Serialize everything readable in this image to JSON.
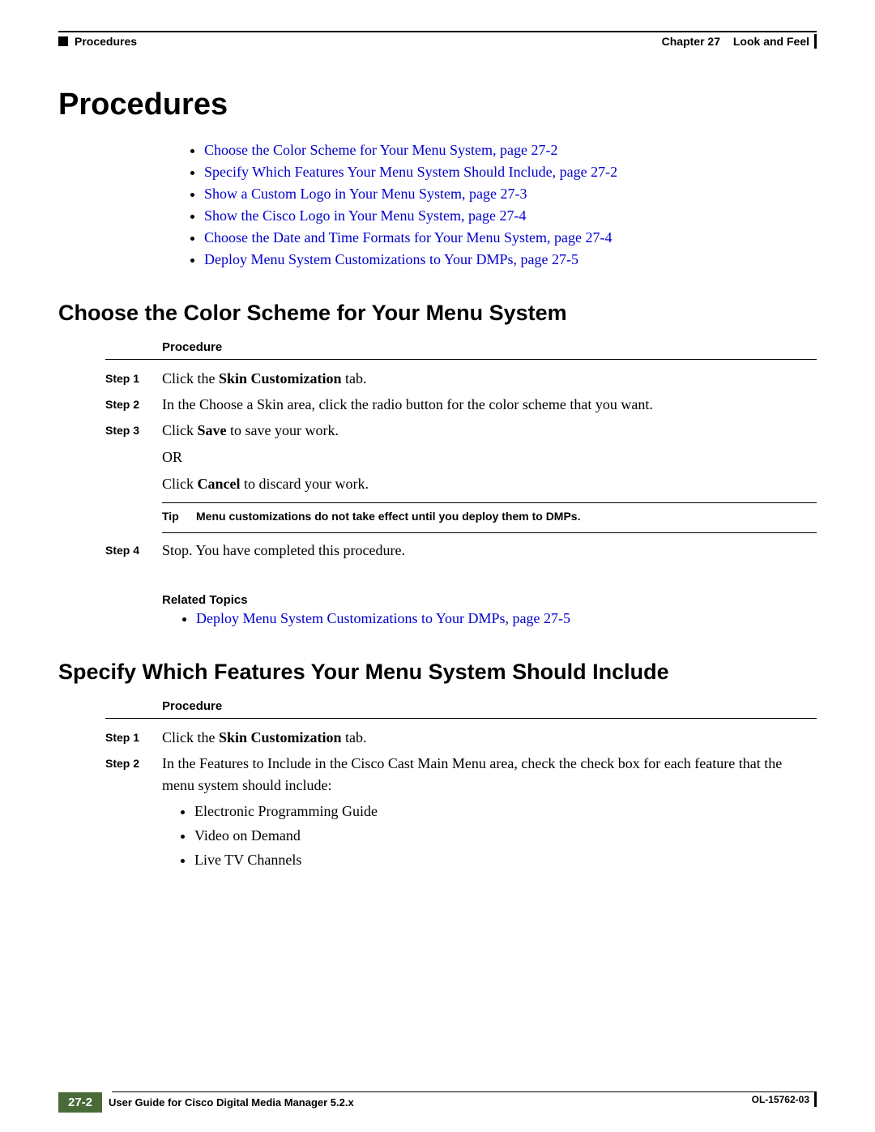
{
  "header": {
    "left": "Procedures",
    "chapter": "Chapter 27",
    "title": "Look and Feel"
  },
  "mainTitle": "Procedures",
  "links": {
    "l1": "Choose the Color Scheme for Your Menu System, page 27-2",
    "l2": "Specify Which Features Your Menu System Should Include, page 27-2",
    "l3": "Show a Custom Logo in Your Menu System, page 27-3",
    "l4": "Show the Cisco Logo in Your Menu System, page 27-4",
    "l5": "Choose the Date and Time Formats for Your Menu System, page 27-4",
    "l6": "Deploy Menu System Customizations to Your DMPs, page 27-5"
  },
  "section1": {
    "heading": "Choose the Color Scheme for Your Menu System",
    "procLabel": "Procedure",
    "step1Label": "Step 1",
    "step1_a": "Click the ",
    "step1_b": "Skin Customization",
    "step1_c": " tab.",
    "step2Label": "Step 2",
    "step2": "In the Choose a Skin area, click the radio button for the color scheme that you want.",
    "step3Label": "Step 3",
    "step3_a": "Click ",
    "step3_b": "Save",
    "step3_c": " to save your work.",
    "or": "OR",
    "cancel_a": "Click ",
    "cancel_b": "Cancel",
    "cancel_c": " to discard your work.",
    "tipLabel": "Tip",
    "tipText": "Menu customizations do not take effect until you deploy them to DMPs.",
    "step4Label": "Step 4",
    "step4": "Stop. You have completed this procedure.",
    "relatedLabel": "Related Topics",
    "relatedLink": "Deploy Menu System Customizations to Your DMPs, page 27-5"
  },
  "section2": {
    "heading": "Specify Which Features Your Menu System Should Include",
    "procLabel": "Procedure",
    "step1Label": "Step 1",
    "step1_a": "Click the ",
    "step1_b": "Skin Customization",
    "step1_c": " tab.",
    "step2Label": "Step 2",
    "step2": "In the Features to Include in the Cisco Cast Main Menu area, check the check box for each feature that the menu system should include:",
    "f1": "Electronic Programming Guide",
    "f2": "Video on Demand",
    "f3": "Live TV Channels"
  },
  "footer": {
    "guideTitle": "User Guide for Cisco Digital Media Manager 5.2.x",
    "pageNum": "27-2",
    "docId": "OL-15762-03"
  }
}
